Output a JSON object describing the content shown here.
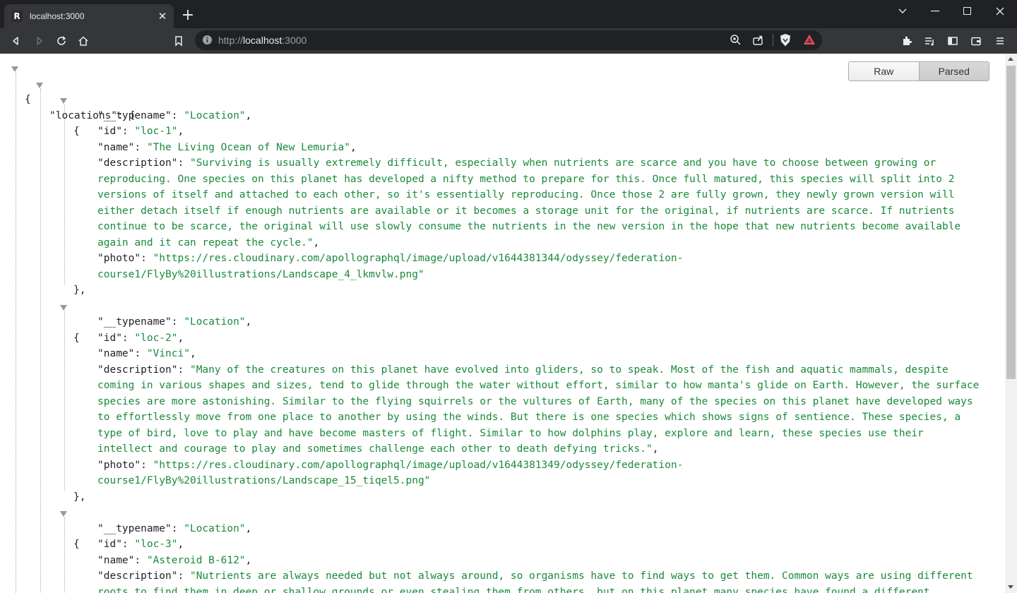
{
  "browser": {
    "tab_title": "localhost:3000",
    "url_scheme": "http://",
    "url_host": "localhost",
    "url_port": ":3000",
    "icons": [
      "back-icon",
      "forward-icon",
      "reload-icon",
      "home-icon",
      "bookmark-icon",
      "info-icon",
      "zoom-icon",
      "share-icon",
      "brave-shield-icon",
      "brave-rewards-icon",
      "extensions-icon",
      "playlist-icon",
      "sidebar-icon",
      "wallet-icon",
      "menu-icon"
    ]
  },
  "viewer": {
    "raw_label": "Raw",
    "parsed_label": "Parsed",
    "root_open": "{",
    "locations_key": "\"locations\"",
    "array_open": "[",
    "obj_open": "{",
    "obj_close": "},"
  },
  "locations": [
    {
      "typename_key": "\"__typename\"",
      "typename_val": "\"Location\"",
      "id_key": "\"id\"",
      "id_val": "\"loc-1\"",
      "name_key": "\"name\"",
      "name_val": "\"The Living Ocean of New Lemuria\"",
      "desc_key": "\"description\"",
      "desc_lines": [
        "\"Surviving is usually extremely difficult, especially when nutrients are scarce and you have to choose between growing or",
        "reproducing. One species on this planet has developed a nifty method to prepare for this. Once full matured, this species will split into 2",
        "versions of itself and attached to each other, so it's essentially reproducing. Once those 2 are fully grown, they newly grown version will",
        "either detach itself if enough nutrients are available or it becomes a storage unit for the original, if nutrients are scarce. If nutrients",
        "continue to be scarce, the original will use slowly consume the nutrients in the new version in the hope that new nutrients become available",
        "again and it can repeat the cycle.\""
      ],
      "photo_key": "\"photo\"",
      "photo_lines": [
        "\"https://res.cloudinary.com/apollographql/image/upload/v1644381344/odyssey/federation-",
        "course1/FlyBy%20illustrations/Landscape_4_lkmvlw.png\""
      ]
    },
    {
      "typename_key": "\"__typename\"",
      "typename_val": "\"Location\"",
      "id_key": "\"id\"",
      "id_val": "\"loc-2\"",
      "name_key": "\"name\"",
      "name_val": "\"Vinci\"",
      "desc_key": "\"description\"",
      "desc_lines": [
        "\"Many of the creatures on this planet have evolved into gliders, so to speak. Most of the fish and aquatic mammals, despite",
        "coming in various shapes and sizes, tend to glide through the water without effort, similar to how manta's glide on Earth. However, the surface",
        "species are more astonishing. Similar to the flying squirrels or the vultures of Earth, many of the species on this planet have developed ways",
        "to effortlessly move from one place to another by using the winds. But there is one species which shows signs of sentience. These species, a",
        "type of bird, love to play and have become masters of flight. Similar to how dolphins play, explore and learn, these species use their",
        "intellect and courage to play and sometimes challenge each other to death defying tricks.\""
      ],
      "photo_key": "\"photo\"",
      "photo_lines": [
        "\"https://res.cloudinary.com/apollographql/image/upload/v1644381349/odyssey/federation-",
        "course1/FlyBy%20illustrations/Landscape_15_tiqel5.png\""
      ]
    },
    {
      "typename_key": "\"__typename\"",
      "typename_val": "\"Location\"",
      "id_key": "\"id\"",
      "id_val": "\"loc-3\"",
      "name_key": "\"name\"",
      "name_val": "\"Asteroid B-612\"",
      "desc_key": "\"description\"",
      "desc_lines": [
        "\"Nutrients are always needed but not always around, so organisms have to find ways to get them. Common ways are using different",
        "roots to find them in deep or shallow grounds or even stealing them from others, but on this planet many species have found a different"
      ]
    }
  ]
}
